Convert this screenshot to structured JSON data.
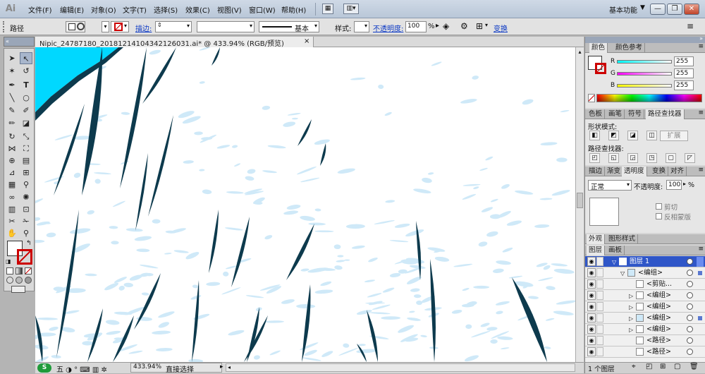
{
  "menubar": {
    "logo": "Ai",
    "items": [
      "文件(F)",
      "编辑(E)",
      "对象(O)",
      "文字(T)",
      "选择(S)",
      "效果(C)",
      "视图(V)",
      "窗口(W)",
      "帮助(H)"
    ],
    "workspace": "基本功能"
  },
  "control": {
    "object_type": "路径",
    "stroke_label": "描边:",
    "stroke_profile": "基本",
    "style_label": "样式:",
    "opacity_label": "不透明度:",
    "opacity_value": "100",
    "opacity_unit": "%",
    "transform_label": "变换"
  },
  "document": {
    "tab_label": "Nipic_24787180_20181214104342126031.ai* @ 433.94% (RGB/预览)",
    "close_glyph": "×"
  },
  "status": {
    "zoom": "433.94%",
    "tool_name": "直接选择"
  },
  "panels": {
    "color": {
      "tabs": [
        "颜色",
        "颜色参考"
      ],
      "channels": [
        {
          "name": "R",
          "value": "255",
          "color": "#ff0000"
        },
        {
          "name": "G",
          "value": "255",
          "color": "#00c000"
        },
        {
          "name": "B",
          "value": "255",
          "color": "#0000ff"
        }
      ]
    },
    "pathfinder": {
      "tabs": [
        "色板",
        "画笔",
        "符号",
        "路径查找器"
      ],
      "shape_modes_label": "形状模式:",
      "expand_label": "扩展",
      "pathfinders_label": "路径查找器:"
    },
    "transparency": {
      "tabs": [
        "描边",
        "渐变",
        "透明度",
        "变换",
        "对齐"
      ],
      "blend_mode": "正常",
      "opacity_label": "不透明度:",
      "opacity_value": "100",
      "opacity_unit": "%",
      "clip_label": "剪切",
      "invert_label": "反相蒙版"
    },
    "appearance": {
      "tabs": [
        "外观",
        "图形样式"
      ]
    },
    "layers": {
      "tabs": [
        "图层",
        "画板"
      ],
      "rows": [
        "图层 1",
        "<编组>",
        "<剪贴...",
        "<编组>",
        "<编组>",
        "<编组>",
        "<编组>",
        "<路径>",
        "<路径>"
      ],
      "footer_count": "1 个图层"
    }
  },
  "colors": {
    "accent_sky": "#00d8ff",
    "ink": "#0d3a4d",
    "water": "#cfe9f8",
    "layer_select": "#2f56c8"
  }
}
